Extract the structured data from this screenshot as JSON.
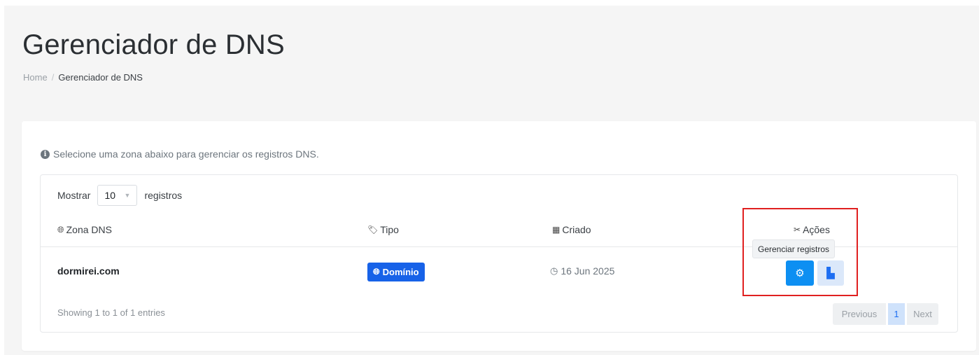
{
  "header": {
    "title": "Gerenciador de DNS",
    "breadcrumb": {
      "home": "Home",
      "separator": "/",
      "current": "Gerenciador de DNS"
    }
  },
  "card": {
    "info_text": "Selecione uma zona abaixo para gerenciar os registros DNS.",
    "info_icon": "info-circle-icon",
    "table": {
      "length": {
        "prefix": "Mostrar",
        "value": "10",
        "suffix": "registros"
      },
      "columns": {
        "zone": "Zona DNS",
        "type": "Tipo",
        "created": "Criado",
        "actions": "Ações"
      },
      "rows": [
        {
          "zone": "dormirei.com",
          "type": "Domínio",
          "created": "16 Jun 2025"
        }
      ],
      "tooltip": "Gerenciar registros",
      "info": "Showing 1 to 1 of 1 entries",
      "pagination": {
        "previous": "Previous",
        "current": "1",
        "next": "Next"
      }
    }
  },
  "colors": {
    "accent_blue": "#1762e8",
    "manage_button": "#0d8ff2",
    "highlight_red": "#e02020"
  }
}
